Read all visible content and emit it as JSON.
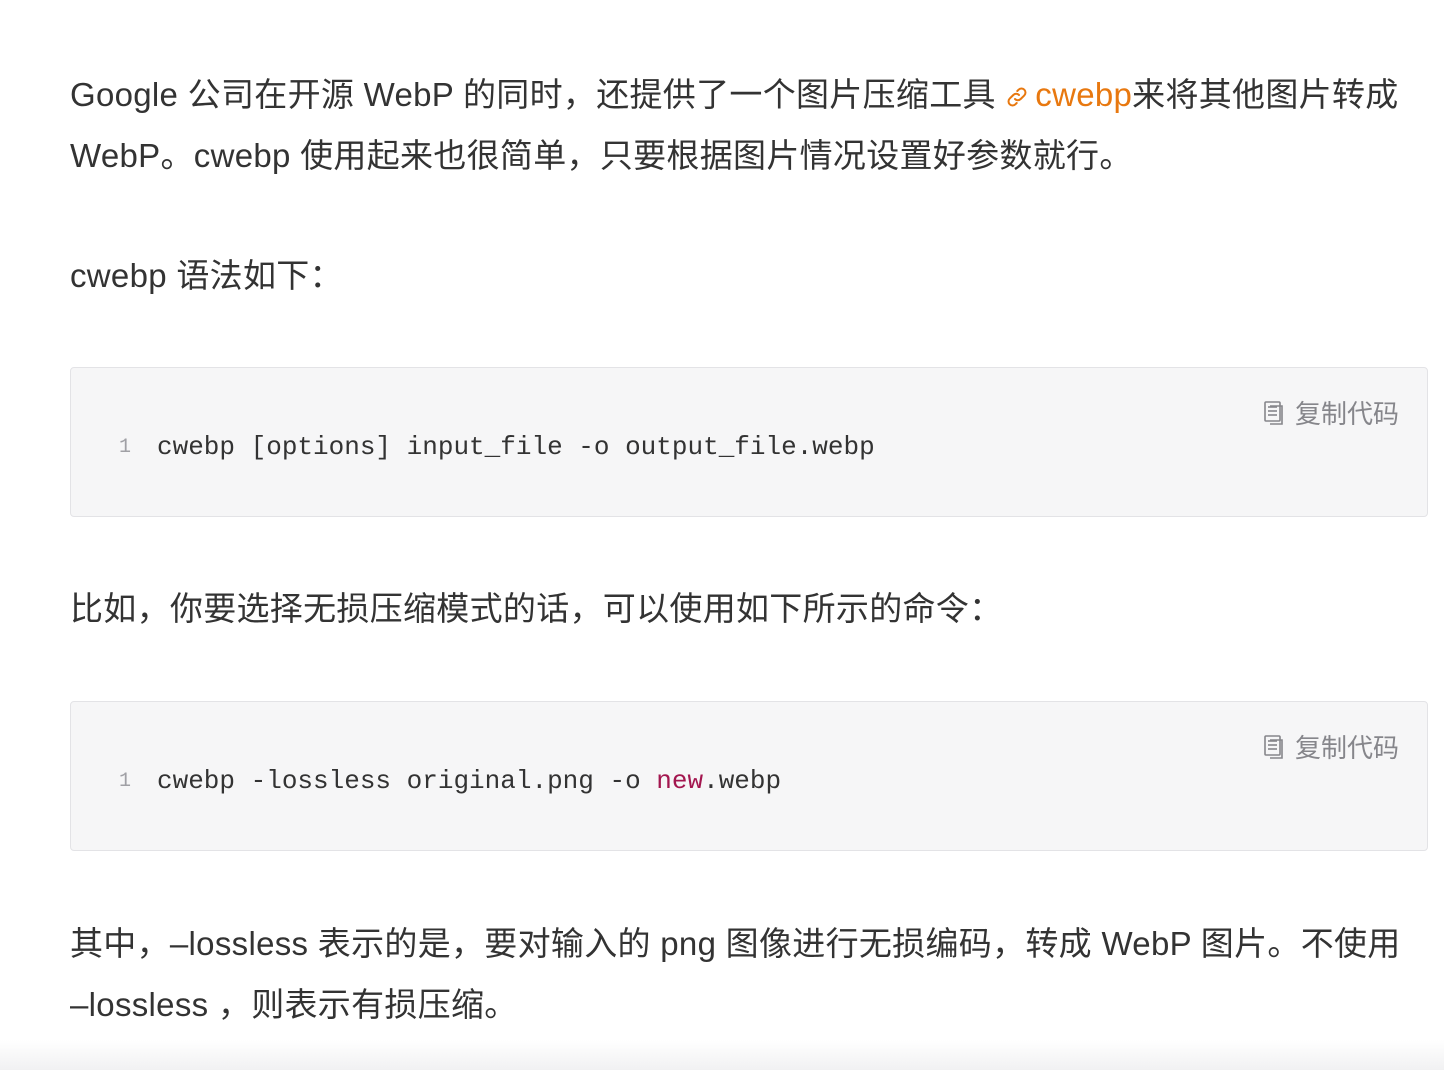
{
  "paragraph1": {
    "before": "Google 公司在开源 WebP 的同时，还提供了一个图片压缩工具 ",
    "link_text": "cwebp",
    "after": "来将其他图片转成 WebP。cwebp 使用起来也很简单，只要根据图片情况设置好参数就行。"
  },
  "paragraph2": "cwebp 语法如下：",
  "code_block_1": {
    "copy_label": "复制代码",
    "line_number": "1",
    "code": "cwebp [options] input_file -o output_file.webp"
  },
  "paragraph3": "比如，你要选择无损压缩模式的话，可以使用如下所示的命令：",
  "code_block_2": {
    "copy_label": "复制代码",
    "line_number": "1",
    "code_before": "cwebp -lossless original.png -o ",
    "code_keyword": "new",
    "code_after": ".webp"
  },
  "paragraph4": "其中，–lossless 表示的是，要对输入的 png 图像进行无损编码，转成 WebP 图片。不使用 –lossless ，则表示有损压缩。",
  "colors": {
    "link": "#e8780f",
    "keyword": "#a3164f",
    "code_bg": "#f6f6f7"
  }
}
